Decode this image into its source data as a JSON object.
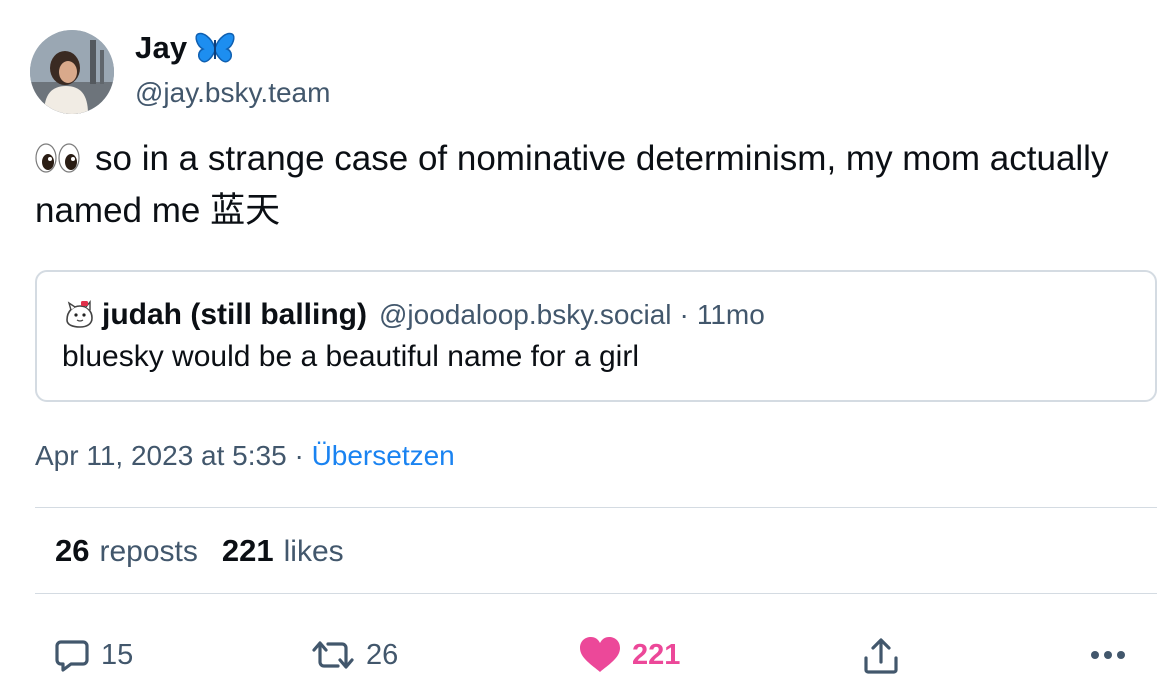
{
  "author": {
    "display_name": "Jay",
    "handle": "@jay.bsky.team",
    "avatar_icon": "person-photo-avatar",
    "badge_icon": "blue-butterfly-emoji"
  },
  "post": {
    "emoji_icon": "eyes-emoji",
    "text": "so in a strange case of nominative determinism, my mom actually named me 蓝天"
  },
  "quote": {
    "avatar_icon": "cartoon-animal-avatar",
    "display_name": "judah (still balling)",
    "handle": "@joodaloop.bsky.social",
    "separator": "·",
    "time": "11mo",
    "text": "bluesky would be a beautiful name for a girl"
  },
  "meta": {
    "timestamp": "Apr 11, 2023 at 5:35",
    "separator": "·",
    "translate_label": "Übersetzen"
  },
  "stats": {
    "reposts_count": "26",
    "reposts_label": "reposts",
    "likes_count": "221",
    "likes_label": "likes"
  },
  "actions": {
    "reply_count": "15",
    "repost_count": "26",
    "like_count": "221",
    "reply_icon": "speech-bubble-icon",
    "repost_icon": "repost-arrows-icon",
    "like_icon": "heart-icon",
    "share_icon": "share-upload-icon",
    "more_icon": "ellipsis-icon"
  },
  "colors": {
    "text": "#0b0f14",
    "muted": "#42576c",
    "link": "#1a83f1",
    "like": "#ec4899",
    "border": "#d4dbe2"
  }
}
